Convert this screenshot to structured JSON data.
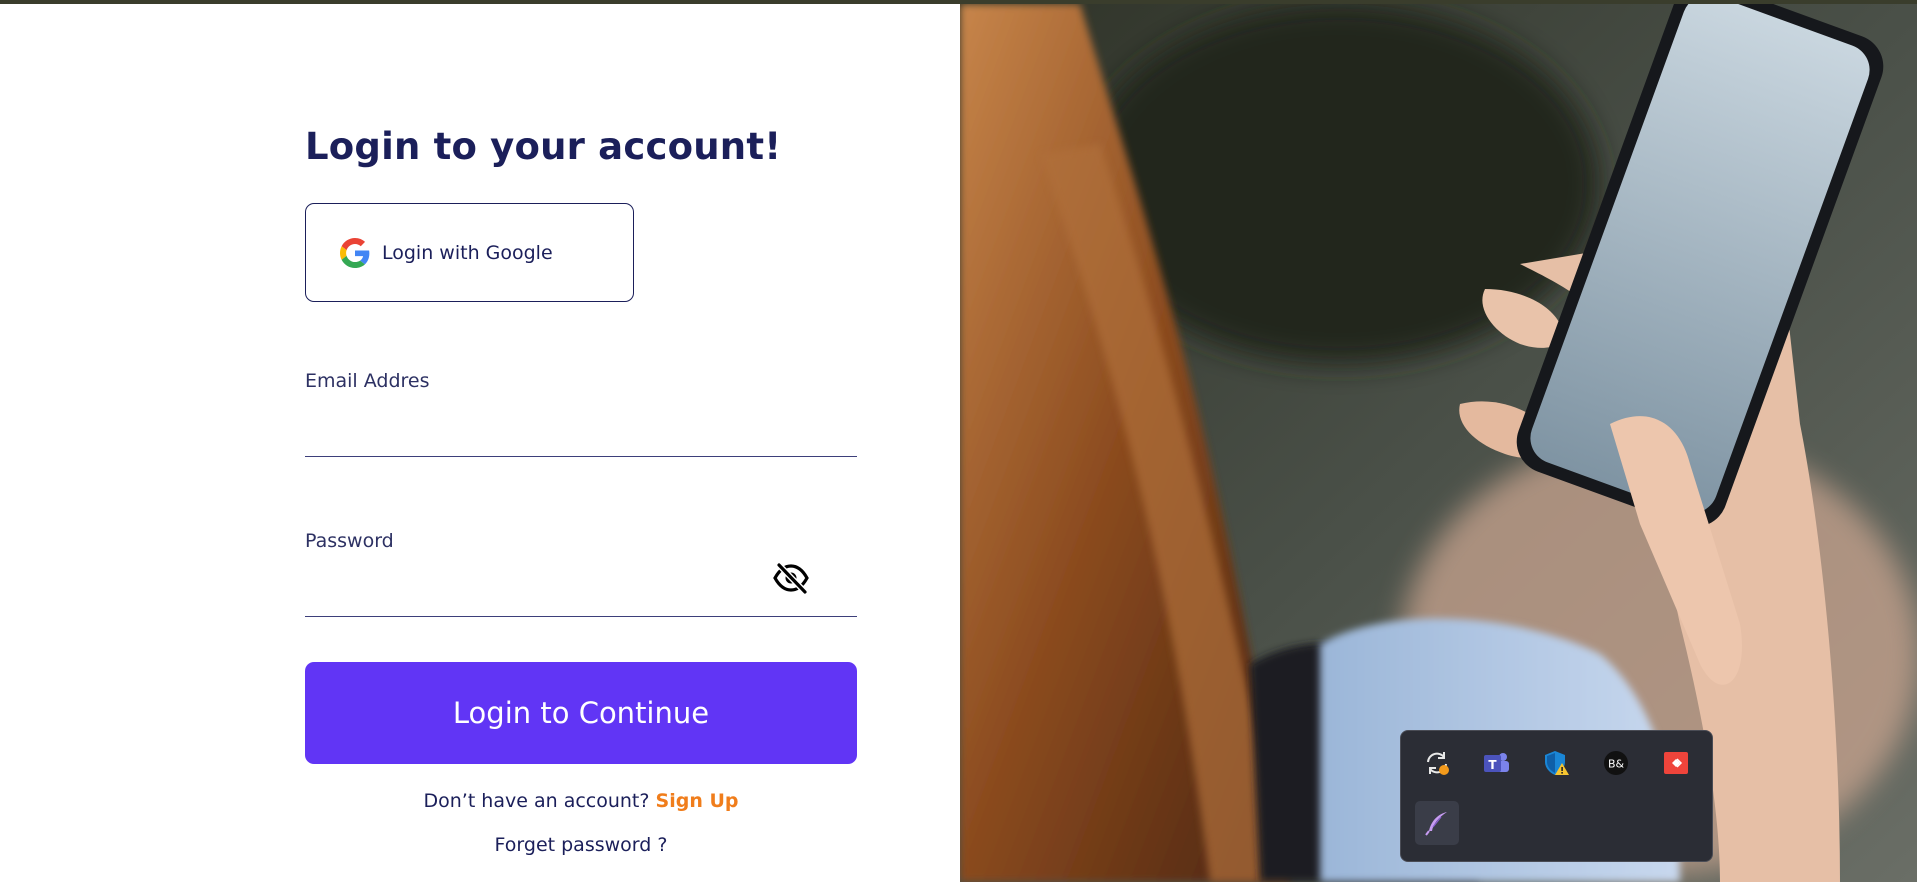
{
  "login": {
    "title": "Login to your account!",
    "google_button_label": "Login with Google",
    "email_label": "Email Addres",
    "email_value": "",
    "password_label": "Password",
    "password_value": "",
    "submit_label": "Login to Continue",
    "signup_prompt": "Don’t have an account?",
    "signup_link": "Sign Up",
    "forget_password": "Forget password ?"
  },
  "tray": {
    "icons": [
      {
        "name": "sync-status-icon"
      },
      {
        "name": "microsoft-teams-icon"
      },
      {
        "name": "windows-security-warning-icon"
      },
      {
        "name": "beats-audio-icon"
      },
      {
        "name": "anydesk-icon"
      },
      {
        "name": "feather-pen-icon"
      }
    ]
  },
  "colors": {
    "primary": "#6135f5",
    "heading": "#1b1f5a",
    "link": "#f07d1b"
  }
}
